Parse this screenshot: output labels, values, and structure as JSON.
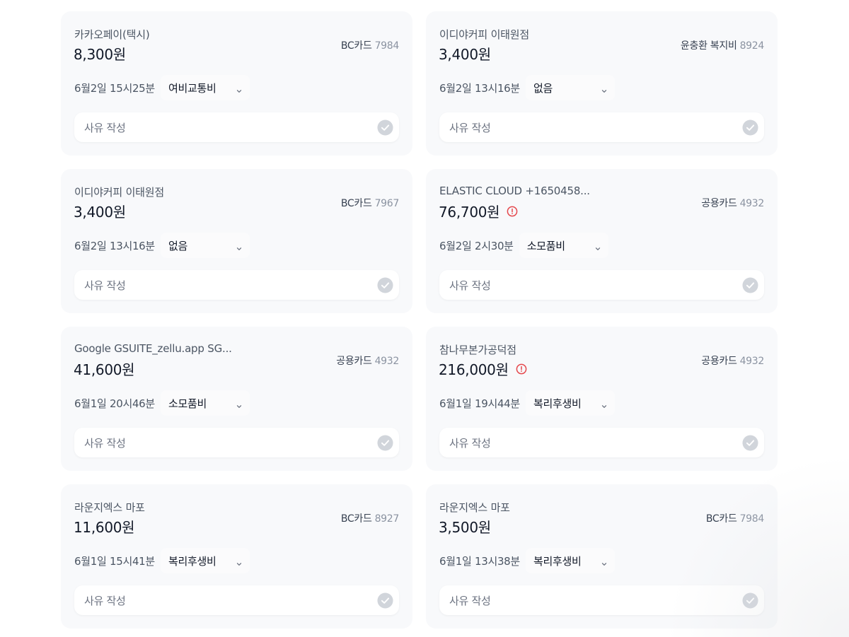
{
  "expenses": [
    {
      "merchant": "카카오페이(택시)",
      "amount": "8,300원",
      "card_name": "BC카드",
      "card_number": "7984",
      "datetime": "6월2일 15시25분",
      "category": "여비교통비",
      "reason_label": "사유 작성",
      "alert": false
    },
    {
      "merchant": "이디야커피 이태원점",
      "amount": "3,400원",
      "card_name": "윤충환 복지비",
      "card_number": "8924",
      "datetime": "6월2일 13시16분",
      "category": "없음",
      "reason_label": "사유 작성",
      "alert": false
    },
    {
      "merchant": "이디야커피 이태원점",
      "amount": "3,400원",
      "card_name": "BC카드",
      "card_number": "7967",
      "datetime": "6월2일 13시16분",
      "category": "없음",
      "reason_label": "사유 작성",
      "alert": false
    },
    {
      "merchant": "ELASTIC CLOUD +1650458...",
      "amount": "76,700원",
      "card_name": "공용카드",
      "card_number": "4932",
      "datetime": "6월2일 2시30분",
      "category": "소모품비",
      "reason_label": "사유 작성",
      "alert": true
    },
    {
      "merchant": "Google GSUITE_zellu.app SG...",
      "amount": "41,600원",
      "card_name": "공용카드",
      "card_number": "4932",
      "datetime": "6월1일 20시46분",
      "category": "소모품비",
      "reason_label": "사유 작성",
      "alert": false
    },
    {
      "merchant": "참나무본가공덕점",
      "amount": "216,000원",
      "card_name": "공용카드",
      "card_number": "4932",
      "datetime": "6월1일 19시44분",
      "category": "복리후생비",
      "reason_label": "사유 작성",
      "alert": true
    },
    {
      "merchant": "라운지엑스 마포",
      "amount": "11,600원",
      "card_name": "BC카드",
      "card_number": "8927",
      "datetime": "6월1일 15시41분",
      "category": "복리후생비",
      "reason_label": "사유 작성",
      "alert": false
    },
    {
      "merchant": "라운지엑스 마포",
      "amount": "3,500원",
      "card_name": "BC카드",
      "card_number": "7984",
      "datetime": "6월1일 13시38분",
      "category": "복리후생비",
      "reason_label": "사유 작성",
      "alert": false
    }
  ],
  "icons": {
    "alert": "alert-circle-icon",
    "chevron": "chevron-down-icon",
    "check": "check-circle-icon"
  },
  "colors": {
    "alert": "#e5484d",
    "check_bg": "#d1d5db",
    "card_bg": "#f8f9fb"
  }
}
